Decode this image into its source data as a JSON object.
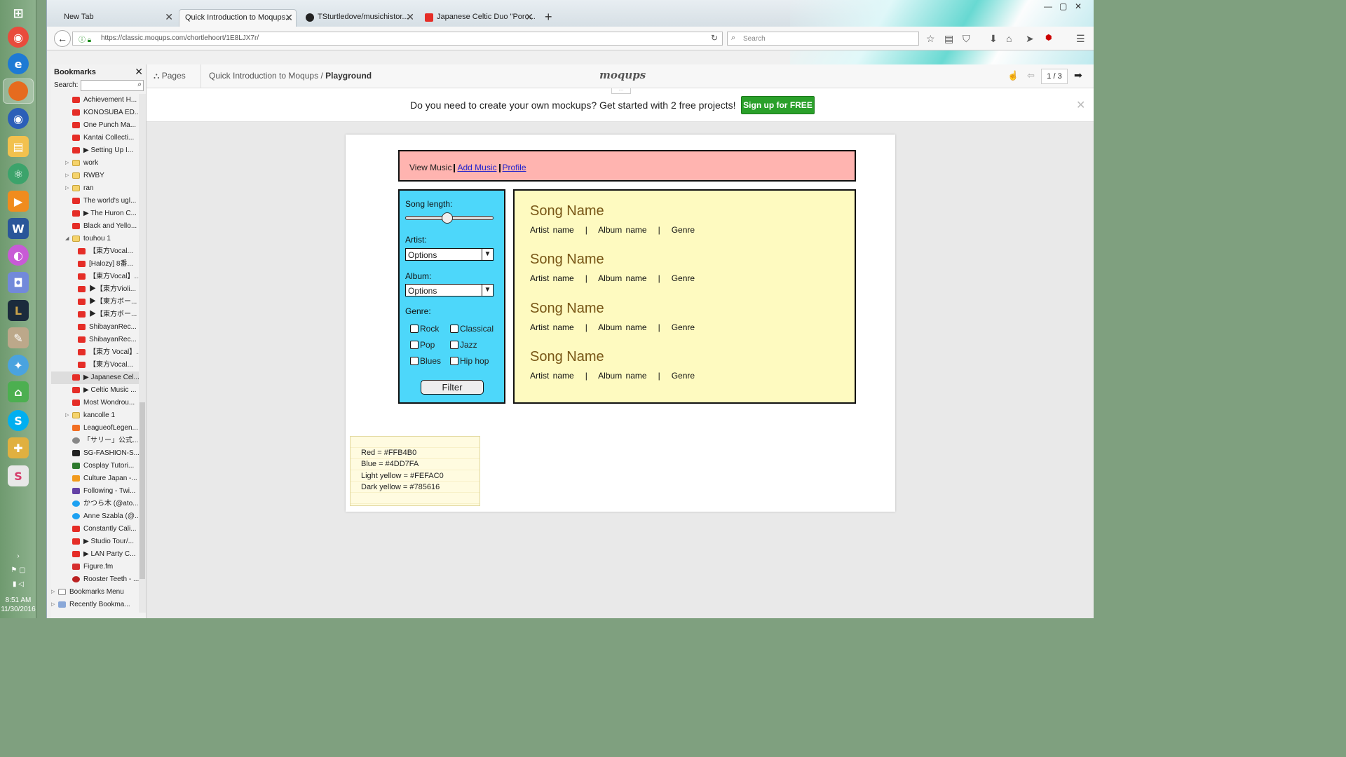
{
  "colors": {
    "red": "#FFB4B0",
    "blue": "#4DD7FA",
    "light_yellow": "#FEFAC0",
    "dark_yellow": "#785616",
    "signup_green": "#2aa02a"
  },
  "taskbar": {
    "icons": [
      "windows-start-icon",
      "chrome-icon",
      "edge-icon",
      "firefox-icon",
      "firefox-dev-icon",
      "file-explorer-icon",
      "atom-icon",
      "media-player-icon",
      "word-icon",
      "paint-icon",
      "discord-icon",
      "league-icon",
      "notepad-icon",
      "pinwheel-icon",
      "home-icon",
      "skype-icon",
      "pinwheel2-icon",
      "slack-icon"
    ],
    "time": "8:51 AM",
    "date": "11/30/2016"
  },
  "browser": {
    "tabs": [
      {
        "label": "New Tab"
      },
      {
        "label": "Quick Introduction to Moqups..."
      },
      {
        "label": "TSturtledove/musichistor..."
      },
      {
        "label": "Japanese Celtic Duo \"Poro..."
      }
    ],
    "url": "https://classic.moqups.com/chortlehoort/1E8LJX7r/",
    "search_placeholder": "Search"
  },
  "sidebar": {
    "title": "Bookmarks",
    "search_label": "Search:",
    "items": [
      {
        "label": "Achievement H...",
        "icon": "youtube-icon",
        "indent": 1
      },
      {
        "label": "KONOSUBA ED...",
        "icon": "youtube-icon",
        "indent": 1
      },
      {
        "label": "One Punch Ma...",
        "icon": "youtube-icon",
        "indent": 1
      },
      {
        "label": "Kantai Collecti...",
        "icon": "youtube-icon",
        "indent": 1
      },
      {
        "label": "▶ Setting Up I...",
        "icon": "youtube-icon",
        "indent": 1
      },
      {
        "label": "work",
        "icon": "folder-icon",
        "indent": 1
      },
      {
        "label": "RWBY",
        "icon": "folder-icon",
        "indent": 1
      },
      {
        "label": "ran",
        "icon": "folder-icon",
        "indent": 1
      },
      {
        "label": "The world's ugl...",
        "icon": "youtube-icon",
        "indent": 1
      },
      {
        "label": "▶ The Huron C...",
        "icon": "youtube-icon",
        "indent": 1
      },
      {
        "label": "Black and Yello...",
        "icon": "youtube-icon",
        "indent": 1
      },
      {
        "label": "touhou 1",
        "icon": "folder-icon",
        "indent": 1
      },
      {
        "label": "【東方Vocal...",
        "icon": "youtube-icon",
        "indent": 2
      },
      {
        "label": "[Halozy] 8番...",
        "icon": "youtube-icon",
        "indent": 2
      },
      {
        "label": "【東方Vocal】...",
        "icon": "youtube-icon",
        "indent": 2
      },
      {
        "label": "▶【東方Violi...",
        "icon": "youtube-icon",
        "indent": 2
      },
      {
        "label": "▶【東方ボー...",
        "icon": "youtube-icon",
        "indent": 2
      },
      {
        "label": "▶【東方ボー...",
        "icon": "youtube-icon",
        "indent": 2
      },
      {
        "label": "ShibayanRec...",
        "icon": "youtube-icon",
        "indent": 2
      },
      {
        "label": "ShibayanRec...",
        "icon": "youtube-icon",
        "indent": 2
      },
      {
        "label": "【東方 Vocal】...",
        "icon": "youtube-icon",
        "indent": 2
      },
      {
        "label": "【東方Vocal...",
        "icon": "youtube-icon",
        "indent": 2
      },
      {
        "label": "▶ Japanese Cel...",
        "icon": "youtube-icon",
        "indent": 1,
        "selected": true
      },
      {
        "label": "▶ Celtic Music ...",
        "icon": "youtube-icon",
        "indent": 1
      },
      {
        "label": "Most Wondrou...",
        "icon": "youtube-icon",
        "indent": 1
      },
      {
        "label": "kancolle 1",
        "icon": "folder-icon",
        "indent": 1
      },
      {
        "label": "LeagueofLegen...",
        "icon": "soundcloud-icon",
        "indent": 1
      },
      {
        "label": "「サリー」公式...",
        "icon": "globe-icon",
        "indent": 1
      },
      {
        "label": "SG-FASHION-S...",
        "icon": "sg-icon",
        "indent": 1
      },
      {
        "label": "Cosplay Tutori...",
        "icon": "cosplay-icon",
        "indent": 1
      },
      {
        "label": "Culture Japan -...",
        "icon": "rss-icon",
        "indent": 1
      },
      {
        "label": "Following - Twi...",
        "icon": "twitch-icon",
        "indent": 1
      },
      {
        "label": "かつら木 (@ato...",
        "icon": "twitter-icon",
        "indent": 1
      },
      {
        "label": "Anne Szabla (@...",
        "icon": "twitter-icon",
        "indent": 1
      },
      {
        "label": "Constantly Cali...",
        "icon": "youtube-icon",
        "indent": 1
      },
      {
        "label": "▶ Studio Tour/...",
        "icon": "youtube-icon",
        "indent": 1
      },
      {
        "label": "▶ LAN Party C...",
        "icon": "youtube-icon",
        "indent": 1
      },
      {
        "label": "Figure.fm",
        "icon": "figure-icon",
        "indent": 1
      },
      {
        "label": "Rooster Teeth - ...",
        "icon": "rooster-icon",
        "indent": 1
      },
      {
        "label": "Bookmarks Menu",
        "icon": "bookmarks-icon",
        "indent": 0
      },
      {
        "label": "Recently Bookma...",
        "icon": "recent-icon",
        "indent": 0
      }
    ]
  },
  "moqups": {
    "pages_label": "Pages",
    "breadcrumb_project": "Quick Introduction to Moqups",
    "breadcrumb_sep": "/",
    "breadcrumb_page": "Playground",
    "logo": "moqups",
    "pager": "1 / 3",
    "promo_text": "Do you need to create your own mockups? Get started with 2 free projects!",
    "signup_label": "Sign up for FREE"
  },
  "mockup": {
    "nav": {
      "view": "View Music",
      "add": "Add Music",
      "profile": "Profile"
    },
    "filter": {
      "song_length_label": "Song length:",
      "song_length_value": 0.48,
      "artist_label": "Artist:",
      "artist_value": "Options",
      "album_label": "Album:",
      "album_value": "Options",
      "genre_label": "Genre:",
      "genres": [
        "Rock",
        "Classical",
        "Pop",
        "Jazz",
        "Blues",
        "Hip hop"
      ],
      "filter_label": "Filter"
    },
    "songs": [
      {
        "name": "Song Name",
        "artist": "Artist name",
        "album": "Album name",
        "genre": "Genre"
      },
      {
        "name": "Song Name",
        "artist": "Artist name",
        "album": "Album name",
        "genre": "Genre"
      },
      {
        "name": "Song Name",
        "artist": "Artist name",
        "album": "Album name",
        "genre": "Genre"
      },
      {
        "name": "Song Name",
        "artist": "Artist name",
        "album": "Album name",
        "genre": "Genre"
      }
    ],
    "meta_separator": "|",
    "note_lines": [
      "Red = #FFB4B0",
      "Blue = #4DD7FA",
      "Light yellow = #FEFAC0",
      "Dark yellow = #785616"
    ]
  }
}
